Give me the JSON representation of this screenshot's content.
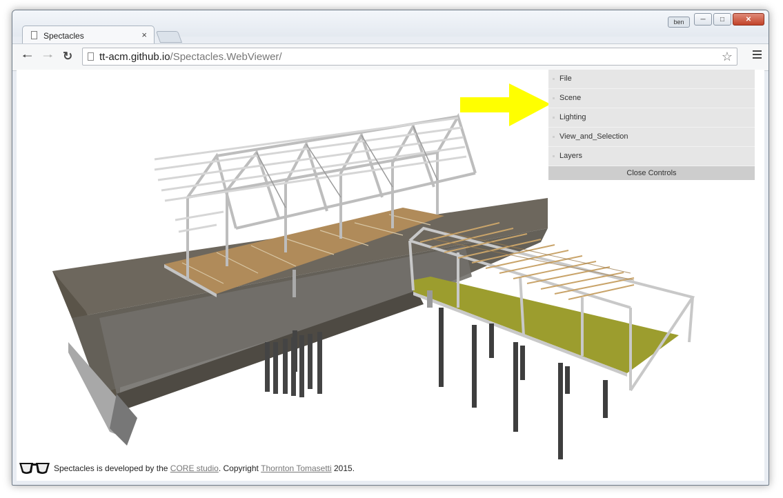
{
  "window": {
    "user_badge": "ben",
    "minimize_icon": "minimize-icon",
    "maximize_icon": "maximize-icon",
    "close_icon": "close-icon"
  },
  "tab": {
    "title": "Spectacles",
    "close_label": "×"
  },
  "toolbar": {
    "back_icon": "back-arrow-icon",
    "forward_icon": "forward-arrow-icon",
    "reload_icon": "reload-icon",
    "url_host": "tt-acm.github.io",
    "url_path": "/Spectacles.WebViewer/",
    "bookmark_icon": "star-icon",
    "menu_icon": "hamburger-menu-icon"
  },
  "controls": {
    "folders": [
      "File",
      "Scene",
      "Lighting",
      "View_and_Selection",
      "Layers"
    ],
    "close_label": "Close Controls"
  },
  "annotation": {
    "arrow_color": "#ffff00"
  },
  "footer": {
    "text_before": "Spectacles is developed by the ",
    "link1": "CORE studio",
    "text_middle": ". Copyright ",
    "link2": "Thornton Tomasetti",
    "text_after": " 2015."
  },
  "colors": {
    "deck_wood": "#b08b5a",
    "deck_green": "#9c9d2e",
    "concrete": "#5b564e",
    "steel": "#bfbfbf"
  }
}
